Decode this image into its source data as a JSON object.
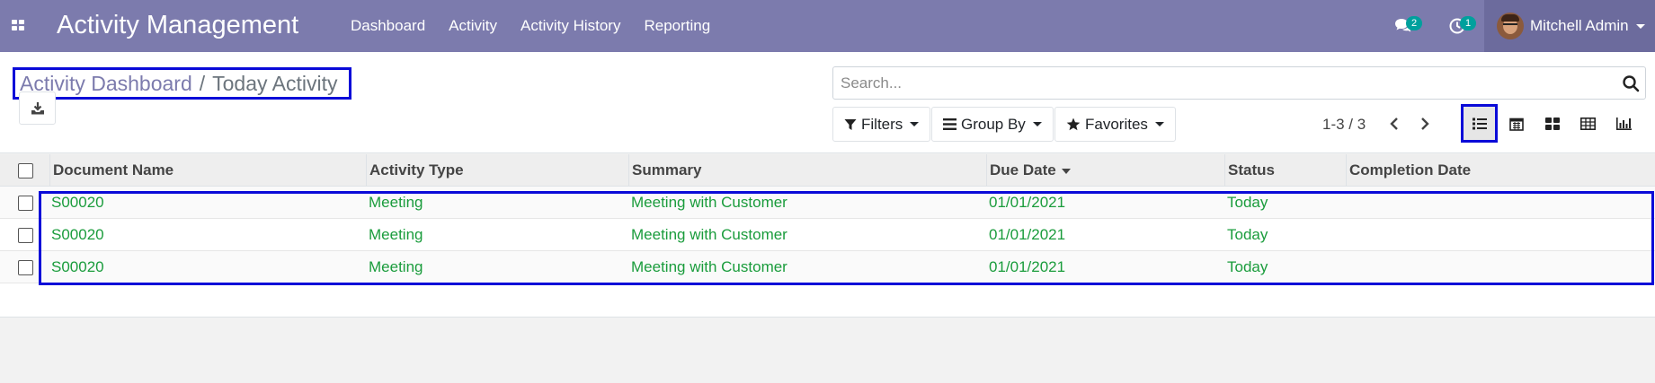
{
  "navbar": {
    "app_title": "Activity Management",
    "menu": [
      "Dashboard",
      "Activity",
      "Activity History",
      "Reporting"
    ],
    "messages_count": "2",
    "activities_count": "1",
    "user_name": "Mitchell Admin",
    "background_color": "#7c7bad"
  },
  "breadcrumb": {
    "parent": "Activity Dashboard",
    "separator": "/",
    "current": "Today Activity"
  },
  "search": {
    "placeholder": "Search..."
  },
  "toolbar": {
    "filters_label": "Filters",
    "group_by_label": "Group By",
    "favorites_label": "Favorites",
    "download_icon": "download-icon"
  },
  "pager": {
    "range": "1-3 / 3"
  },
  "views": [
    "list-view",
    "calendar-view",
    "kanban-view",
    "pivot-view",
    "graph-view"
  ],
  "table": {
    "columns": [
      "Document Name",
      "Activity Type",
      "Summary",
      "Due Date",
      "Status",
      "Completion Date"
    ],
    "sorted_column": "Due Date",
    "row_text_color": "#1a9c3c",
    "rows": [
      {
        "document_name": "S00020",
        "activity_type": "Meeting",
        "summary": "Meeting with Customer",
        "due_date": "01/01/2021",
        "status": "Today",
        "completion_date": ""
      },
      {
        "document_name": "S00020",
        "activity_type": "Meeting",
        "summary": "Meeting with Customer",
        "due_date": "01/01/2021",
        "status": "Today",
        "completion_date": ""
      },
      {
        "document_name": "S00020",
        "activity_type": "Meeting",
        "summary": "Meeting with Customer",
        "due_date": "01/01/2021",
        "status": "Today",
        "completion_date": ""
      }
    ]
  },
  "highlight_color": "#0a0ad8"
}
